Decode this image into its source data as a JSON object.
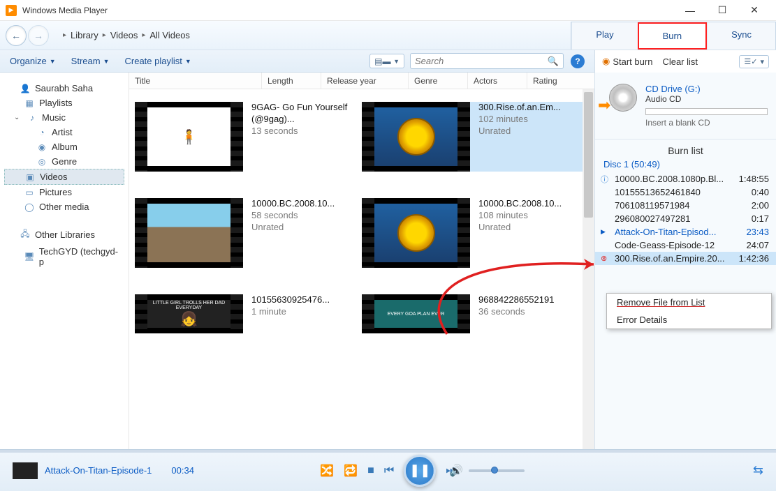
{
  "window": {
    "title": "Windows Media Player"
  },
  "breadcrumb": {
    "library": "Library",
    "videos": "Videos",
    "allvideos": "All Videos"
  },
  "tabs": {
    "play": "Play",
    "burn": "Burn",
    "sync": "Sync"
  },
  "toolbar": {
    "organize": "Organize",
    "stream": "Stream",
    "create_playlist": "Create playlist",
    "search_placeholder": "Search"
  },
  "burnbar": {
    "start_burn": "Start burn",
    "clear_list": "Clear list"
  },
  "sidebar": {
    "user": "Saurabh Saha",
    "playlists": "Playlists",
    "music": "Music",
    "artist": "Artist",
    "album": "Album",
    "genre": "Genre",
    "videos": "Videos",
    "pictures": "Pictures",
    "other_media": "Other media",
    "other_libraries": "Other Libraries",
    "techgyd": "TechGYD (techgyd-p"
  },
  "columns": {
    "title": "Title",
    "length": "Length",
    "release": "Release year",
    "genre": "Genre",
    "actors": "Actors",
    "rating": "Rating"
  },
  "videos": [
    {
      "title": "9GAG- Go Fun Yourself (@9gag)...",
      "dur": "13 seconds",
      "rating": ""
    },
    {
      "title": "300.Rise.of.an.Em...",
      "dur": "102 minutes",
      "rating": "Unrated"
    },
    {
      "title": "10000.BC.2008.10...",
      "dur": "58 seconds",
      "rating": "Unrated"
    },
    {
      "title": "10000.BC.2008.10...",
      "dur": "108 minutes",
      "rating": "Unrated"
    },
    {
      "title": "10155630925476...",
      "dur": "1 minute",
      "rating": ""
    },
    {
      "title": "968842286552191",
      "dur": "36 seconds",
      "rating": ""
    }
  ],
  "girl_text": "LITTLE GIRL TROLLS HER DAD EVERYDAY",
  "teal_text": "EVERY GOA PLAN EVER",
  "drive": {
    "name": "CD Drive (G:)",
    "type": "Audio CD",
    "msg": "Insert a blank CD"
  },
  "burnlist": {
    "heading": "Burn list",
    "disc": "Disc 1 (50:49)",
    "items": [
      {
        "name": "10000.BC.2008.1080p.Bl...",
        "dur": "1:48:55",
        "mark": "info"
      },
      {
        "name": "10155513652461840",
        "dur": "0:40"
      },
      {
        "name": "706108119571984",
        "dur": "2:00"
      },
      {
        "name": "296080027497281",
        "dur": "0:17"
      },
      {
        "name": "Attack-On-Titan-Episod...",
        "dur": "23:43",
        "mark": "play"
      },
      {
        "name": "Code-Geass-Episode-12",
        "dur": "24:07"
      },
      {
        "name": "300.Rise.of.an.Empire.20...",
        "dur": "1:42:36",
        "mark": "err"
      }
    ]
  },
  "ctxmenu": {
    "remove": "Remove File from List",
    "details": "Error Details"
  },
  "player": {
    "title": "Attack-On-Titan-Episode-1",
    "time": "00:34"
  }
}
